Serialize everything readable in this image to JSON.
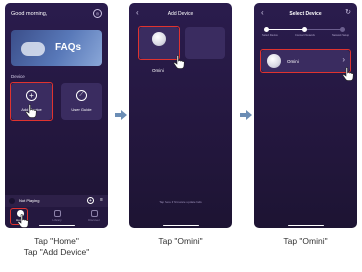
{
  "screen1": {
    "greeting": "Good morning,",
    "faq_title": "FAQs",
    "section_label": "Device",
    "tiles": [
      {
        "label": "Add Device",
        "icon": "plus-circle-icon"
      },
      {
        "label": "User Guide",
        "icon": "compass-icon"
      }
    ],
    "now_playing": "Not Playing",
    "tabs": [
      {
        "label": "Home",
        "icon": "home-icon"
      },
      {
        "label": "Library",
        "icon": "library-icon"
      },
      {
        "label": "Discover",
        "icon": "discover-icon"
      }
    ]
  },
  "screen2": {
    "title": "Add Device",
    "device_name": "Omini",
    "footnote": "Tap here if firmware update fails"
  },
  "screen3": {
    "title": "Select Device",
    "steps": [
      "Select Device",
      "Connect Network",
      "Network Setup"
    ],
    "device_name": "Omini"
  },
  "captions": {
    "step1_line1": "Tap \"Home\"",
    "step1_line2": "Tap \"Add Device\"",
    "step2": "Tap \"Omini\"",
    "step3": "Tap \"Omini\""
  },
  "colors": {
    "highlight": "#e0332f",
    "arrow": "#6b8db5",
    "app_background": "#2a1c4d"
  }
}
